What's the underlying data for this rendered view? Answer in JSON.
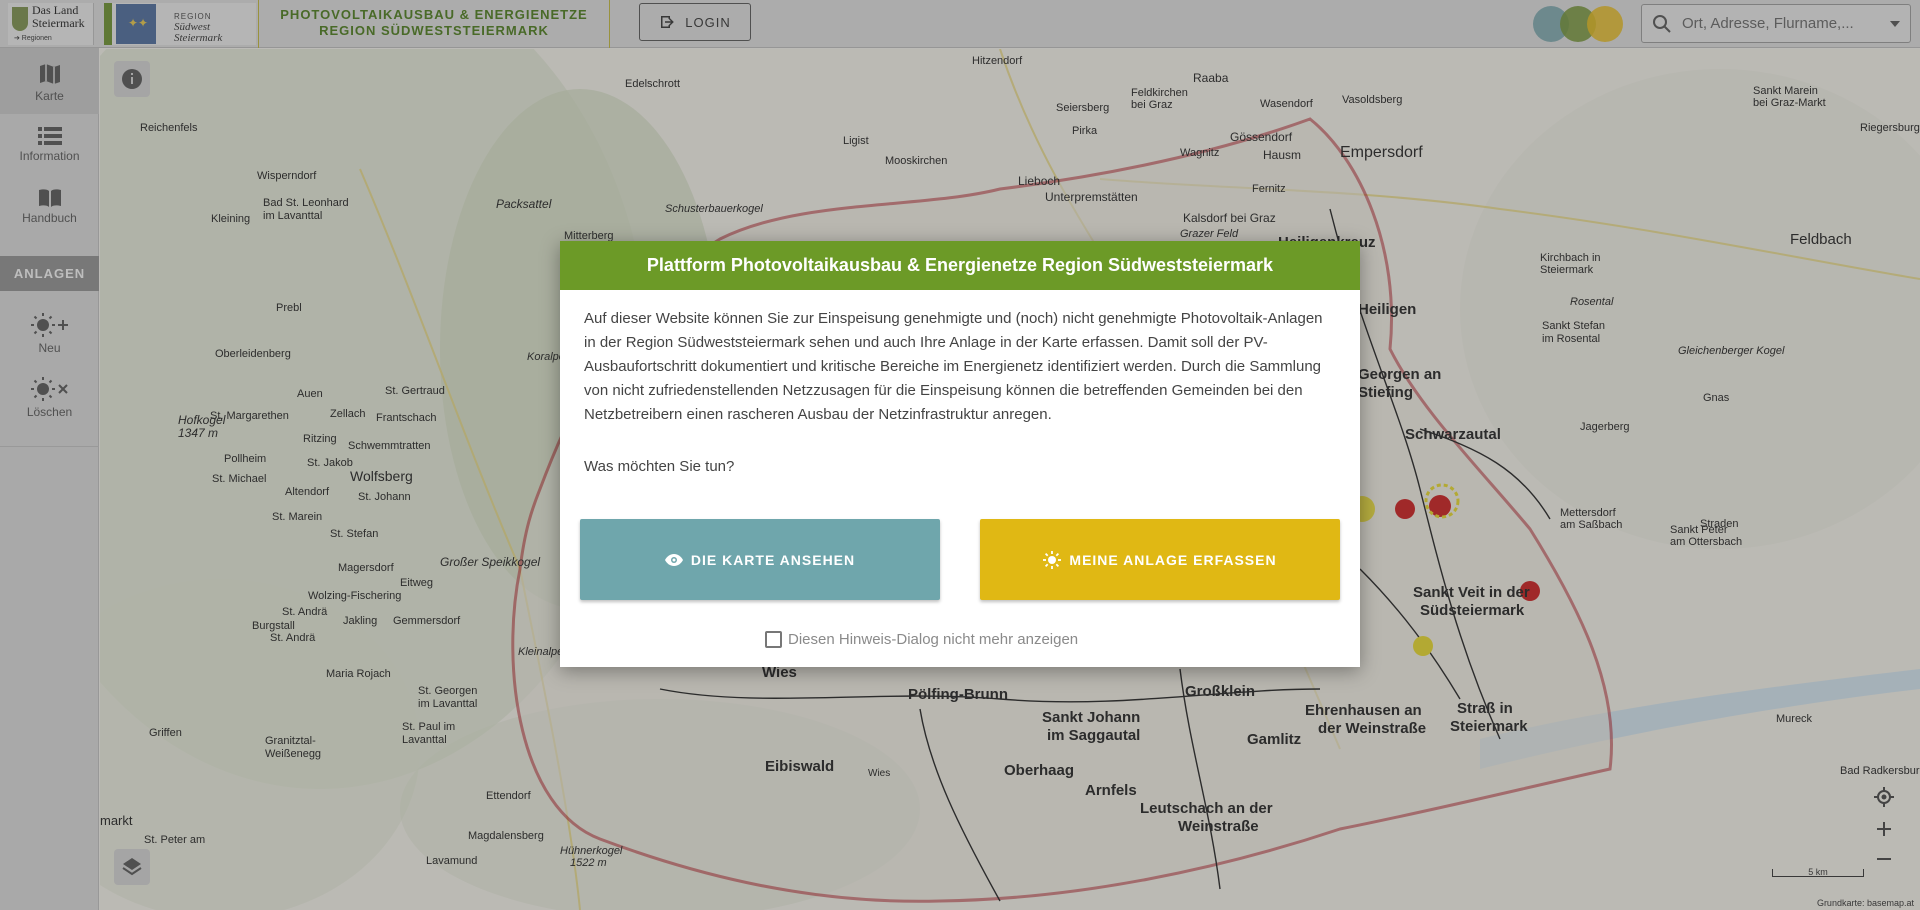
{
  "header": {
    "land_logo": {
      "line1": "Das Land",
      "line2": "Steiermark",
      "line3": "➔ Regionen"
    },
    "region_logo": {
      "line1": "REGION",
      "line2": "Südwest",
      "line3": "Steiermark"
    },
    "title_line1": "PHOTOVOLTAIKAUSBAU & ENERGIENETZE",
    "title_line2": "REGION SÜDWESTSTEIERMARK",
    "login_label": "LOGIN",
    "search_placeholder": "Ort, Adresse, Flurname,...",
    "circle_colors": [
      "#6f9fa4",
      "#6f8f2f",
      "#e3b71c"
    ],
    "brand_color": "#4b7a1c"
  },
  "sidebar": {
    "items": [
      {
        "label": "Karte",
        "icon": "map-icon"
      },
      {
        "label": "Information",
        "icon": "list-icon"
      },
      {
        "label": "Handbuch",
        "icon": "book-icon"
      }
    ],
    "section_label": "ANLAGEN",
    "anlagen_items": [
      {
        "label": "Neu",
        "icon": "sun-plus-icon"
      },
      {
        "label": "Löschen",
        "icon": "sun-remove-icon"
      }
    ]
  },
  "map": {
    "attribution": "Grundkarte: basemap.at",
    "scale_label": "5 km",
    "border_color": "#b0202a",
    "place_labels": [
      {
        "text": "Empersdorf"
      },
      {
        "text": "Feldbach"
      },
      {
        "text": "Wolfsberg"
      },
      {
        "text": "Schwarzautal"
      },
      {
        "text": "Sankt Veit in der"
      },
      {
        "text": "Südsteiermark"
      },
      {
        "text": "Ehrenhausen an"
      },
      {
        "text": "der Weinstraße"
      },
      {
        "text": "Straß in"
      },
      {
        "text": "Steiermark"
      },
      {
        "text": "Eibiswald"
      },
      {
        "text": "Wies"
      },
      {
        "text": "Pölfing-Brunn"
      },
      {
        "text": "Sankt Johann"
      },
      {
        "text": "im Saggautal"
      },
      {
        "text": "Großklein"
      },
      {
        "text": "Gamlitz"
      },
      {
        "text": "Oberhaag"
      },
      {
        "text": "Arnfels"
      },
      {
        "text": "Leutschach an der"
      },
      {
        "text": "Weinstraße"
      },
      {
        "text": "Heiligenkreuz"
      },
      {
        "text": "Lieboch"
      },
      {
        "text": "Unterpremstätten"
      },
      {
        "text": "Kalsdorf bei Graz"
      },
      {
        "text": "Raaba"
      },
      {
        "text": "Gössendorf"
      },
      {
        "text": "Hausm"
      },
      {
        "text": "Gleichenberger Kogel"
      },
      {
        "text": "Sankt Stefan"
      },
      {
        "text": "im Rosental"
      },
      {
        "text": "Packsattel"
      },
      {
        "text": "Edelschrott"
      },
      {
        "text": "Hitzendorf"
      },
      {
        "text": "Seiersberg"
      },
      {
        "text": "Pirka"
      },
      {
        "text": "Mooskirchen"
      },
      {
        "text": "Ligist"
      },
      {
        "text": "Mitterberg"
      },
      {
        "text": "Reichenfels"
      },
      {
        "text": "Bad St. Leonhard"
      },
      {
        "text": "im Lavanttal"
      },
      {
        "text": "Prebl"
      },
      {
        "text": "Auen"
      },
      {
        "text": "St. Gertraud"
      },
      {
        "text": "Zellach"
      },
      {
        "text": "Frantschach"
      },
      {
        "text": "St. Margarethen"
      },
      {
        "text": "Ritzing"
      },
      {
        "text": "Schwemmtratten"
      },
      {
        "text": "Pollheim"
      },
      {
        "text": "St. Jakob"
      },
      {
        "text": "St. Michael"
      },
      {
        "text": "Altendorf"
      },
      {
        "text": "St. Johann"
      },
      {
        "text": "St. Marein"
      },
      {
        "text": "St. Stefan"
      },
      {
        "text": "Magersdorf"
      },
      {
        "text": "Eitweg"
      },
      {
        "text": "St. Andrä"
      },
      {
        "text": "Burgstall"
      },
      {
        "text": "Jakling"
      },
      {
        "text": "Gemmersdorf"
      },
      {
        "text": "Maria Rojach"
      },
      {
        "text": "St. Georgen"
      },
      {
        "text": "im Lavanttal"
      },
      {
        "text": "St. Paul im"
      },
      {
        "text": "Lavanttal"
      },
      {
        "text": "Griffen"
      },
      {
        "text": "Granitztal-"
      },
      {
        "text": "Weißenegg"
      },
      {
        "text": "Ettendorf"
      },
      {
        "text": "Magdalensberg"
      },
      {
        "text": "Lavamund"
      },
      {
        "text": "Hühnerkogel"
      },
      {
        "text": "1522 m"
      },
      {
        "text": "St. Peter am"
      },
      {
        "text": "markt"
      },
      {
        "text": "Murеck"
      },
      {
        "text": "Bad Radkersburg"
      },
      {
        "text": "Riegersburg"
      },
      {
        "text": "Sankt Marein"
      },
      {
        "text": "bei Graz-Markt"
      },
      {
        "text": "Kirchbach in"
      },
      {
        "text": "Steiermark"
      },
      {
        "text": "Rosental"
      },
      {
        "text": "Jagerberg"
      },
      {
        "text": "Mettersdorf"
      },
      {
        "text": "am Saßbach"
      },
      {
        "text": "Sankt Peter"
      },
      {
        "text": "am Ottersbach"
      },
      {
        "text": "Straden"
      },
      {
        "text": "Gnas"
      },
      {
        "text": "Feldkirchen"
      },
      {
        "text": "bei Graz"
      },
      {
        "text": "Fernitz"
      },
      {
        "text": "Wagnitz"
      },
      {
        "text": "Grazer Feld"
      },
      {
        "text": "Wasendorf"
      },
      {
        "text": "Kleining"
      },
      {
        "text": "Wisperndorf"
      },
      {
        "text": "Koralpe"
      },
      {
        "text": "Großer Speikkogel"
      },
      {
        "text": "Kleinalpe"
      },
      {
        "text": "Hofkogel"
      },
      {
        "text": "1347 m"
      },
      {
        "text": "Oberleidenberg"
      },
      {
        "text": "St. Andrä"
      },
      {
        "text": "Wolzing-Fischering"
      },
      {
        "text": "Schusterbauerkogel"
      },
      {
        "text": "Vasoldsberg"
      },
      {
        "text": "Wies"
      },
      {
        "text": "Eibiswald"
      },
      {
        "text": "Heiligen"
      },
      {
        "text": "Georgen an"
      },
      {
        "text": "Stiefing"
      }
    ]
  },
  "dialog": {
    "title": "Plattform Photovoltaikausbau & Energienetze Region Südweststeiermark",
    "body": "Auf dieser Website können Sie zur Einspeisung genehmigte und (noch) nicht genehmigte Photovoltaik-Anlagen in der Region Südweststeiermark sehen und auch Ihre Anlage in der Karte erfassen. Damit soll der PV-Ausbaufortschritt dokumentiert und kritische Bereiche im Energienetz identifiziert werden. Durch die Sammlung von nicht zufriedenstellenden Netzzusagen für die Einspeisung können die betreffenden Gemeinden bei den Netzbetreibern einen rascheren Ausbau der Netzinfrastruktur anregen.",
    "question": "Was möchten Sie tun?",
    "primary_button": "DIE KARTE ANSEHEN",
    "secondary_button": "MEINE ANLAGE ERFASSEN",
    "checkbox_label": "Diesen Hinweis-Dialog nicht mehr anzeigen",
    "checkbox_checked": false,
    "header_color": "#6c9a27",
    "primary_color": "#6fa6ac",
    "secondary_color": "#e0b814"
  }
}
